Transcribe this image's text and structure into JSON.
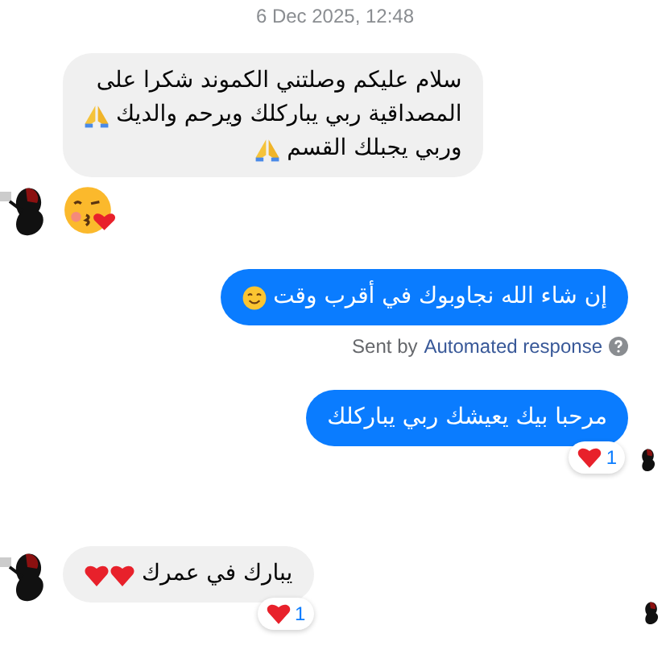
{
  "timestamp": "6 Dec 2025, 12:48",
  "messages": [
    {
      "kind": "incoming",
      "avatar": false,
      "seen": false,
      "lines": [
        {
          "text": "سلام عليكم وصلتني الكموند شكرا على",
          "kind": "plain"
        },
        {
          "text": "المصداقية ربي يباركلك ويرحم والديك",
          "kind": "pray"
        },
        {
          "text": "وربي يجبلك القسم",
          "kind": "pray"
        }
      ]
    },
    {
      "kind": "sticker",
      "avatar": true
    },
    {
      "kind": "outgoing",
      "lines": [
        {
          "text": "إن شاء الله نجاوبوك في أقرب وقت",
          "kind": "smile"
        }
      ],
      "sent_by": {
        "prefix": "Sent by",
        "link": "Automated response"
      },
      "seen": false
    },
    {
      "kind": "outgoing",
      "lines": [
        {
          "text": "مرحبا بيك يعيشك ربي يباركلك",
          "kind": "plain"
        }
      ],
      "reaction": {
        "count": "1"
      },
      "seen": true
    },
    {
      "kind": "incoming",
      "avatar": true,
      "lines": [
        {
          "text": "يبارك في عمرك",
          "kind": "hearts"
        }
      ],
      "reaction": {
        "count": "1"
      },
      "seen": true
    }
  ]
}
